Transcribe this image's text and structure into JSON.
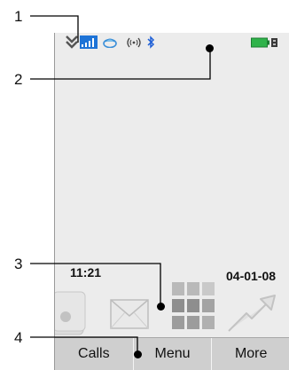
{
  "callouts": [
    "1",
    "2",
    "3",
    "4"
  ],
  "standby": {
    "time": "11:21",
    "date": "04-01-08"
  },
  "softkeys": {
    "left": "Calls",
    "center": "Menu",
    "right": "More"
  },
  "status_icons": [
    "new-event-icon",
    "signal-strength-icon",
    "online-icon",
    "wireless-icon",
    "bluetooth-icon",
    "battery-icon"
  ],
  "desktop_icons": [
    "contacts-icon",
    "messaging-icon",
    "main-menu-grid-icon",
    "send-arrow-icon"
  ],
  "colors": {
    "screen": "#ececec",
    "softkey_bar": "#cfcfcf",
    "signal": "#1e73d6",
    "battery": "#2fb34a",
    "bluetooth": "#1e5fd6"
  }
}
